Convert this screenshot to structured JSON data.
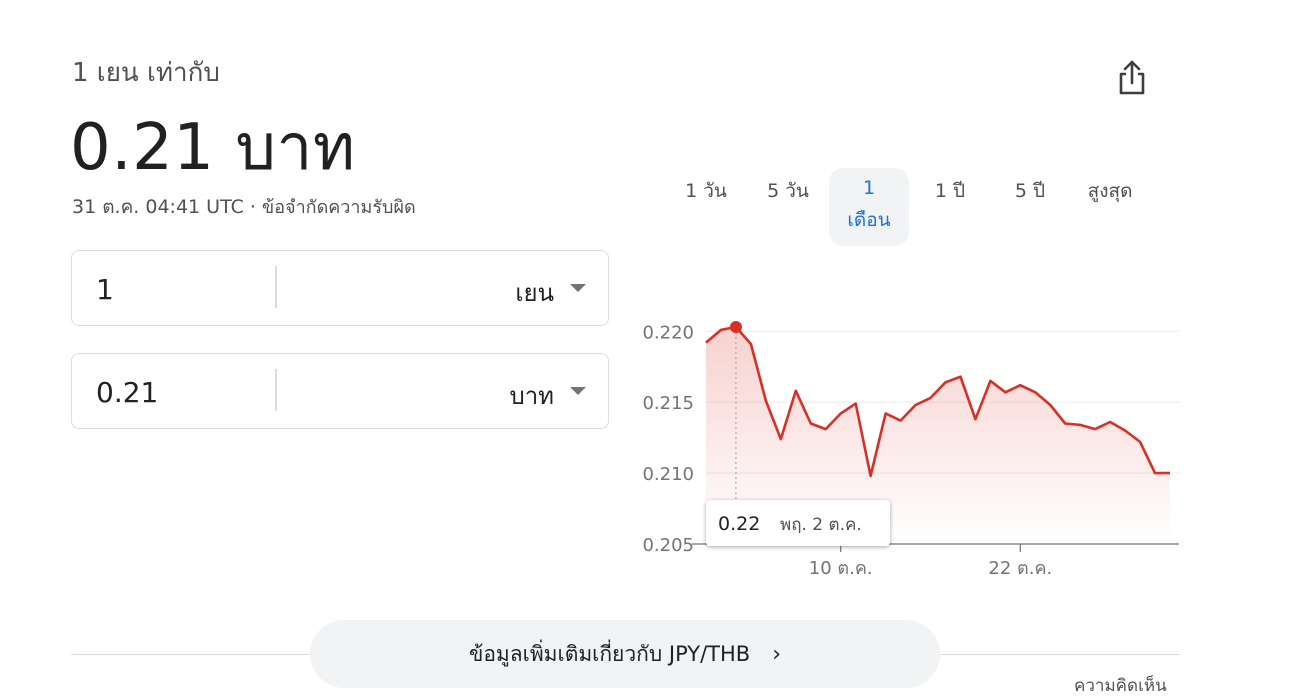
{
  "header": {
    "equivalence_label": "1 เยน เท่ากับ",
    "converted_value": "0.21 บาท",
    "timestamp": "31 ต.ค. 04:41 UTC",
    "separator": "·",
    "disclaimer_link": "ข้อจำกัดความรับผิด"
  },
  "share": {
    "icon": "share-icon"
  },
  "converter": {
    "from": {
      "value": "1",
      "currency": "เยน"
    },
    "to": {
      "value": "0.21",
      "currency": "บาท"
    }
  },
  "ranges": {
    "d1": "1 วัน",
    "d5": "5 วัน",
    "m1_line1": "1",
    "m1_line2": "เดือน",
    "y1": "1 ปี",
    "y5": "5 ปี",
    "max": "สูงสุด",
    "selected": "1 เดือน"
  },
  "colors": {
    "line": "#d93025",
    "selected_tab": "#1a73e8",
    "tab_bg": "#f1f3f4"
  },
  "chart_data": {
    "type": "line",
    "y_ticks": [
      "0.220",
      "0.215",
      "0.210",
      "0.205"
    ],
    "x_ticks": [
      "10 ต.ค.",
      "22 ต.ค."
    ],
    "ylim": [
      0.205,
      0.2215
    ],
    "grid": true,
    "series": [
      {
        "values": [
          0.2192,
          0.2201,
          0.2203,
          0.2191,
          0.2151,
          0.2124,
          0.2158,
          0.2135,
          0.2131,
          0.2142,
          0.2149,
          0.2098,
          0.2142,
          0.2137,
          0.2148,
          0.2153,
          0.2164,
          0.2168,
          0.2138,
          0.2165,
          0.2157,
          0.2162,
          0.2157,
          0.2148,
          0.2135,
          0.2134,
          0.2131,
          0.2136,
          0.213,
          0.2122,
          0.21,
          0.21
        ]
      }
    ],
    "tooltip": {
      "value": "0.22",
      "date": "พฤ. 2 ต.ค."
    },
    "highlight_index": 2
  },
  "more_info": {
    "label": "ข้อมูลเพิ่มเติมเกี่ยวกับ JPY/THB",
    "chevron": "›"
  },
  "feedback": "ความคิดเห็น"
}
